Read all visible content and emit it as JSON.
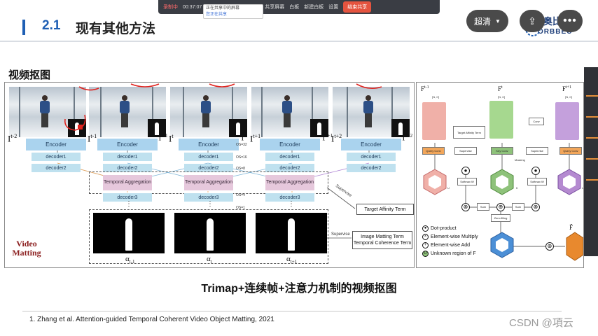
{
  "meeting_bar": {
    "record_label": "录制中",
    "timer": "00:37:07",
    "tip_line1": "正在共享中的屏幕",
    "tip_line2": "您正在共享",
    "items": [
      "共享屏幕",
      "白板",
      "新建白板",
      "设置",
      "结束共享"
    ],
    "end_label": "结束共享"
  },
  "slide": {
    "section_number": "2.1",
    "section_title": "现有其他方法",
    "subheading": "视频抠图",
    "caption": "Trimap+连续帧+注意力机制的视频抠图",
    "reference": "1. Zhang et al. Attention-guided Temporal Coherent Video Object Matting, 2021"
  },
  "logo": {
    "cn": "奥比中光",
    "en": "ORBBEC"
  },
  "controls": {
    "quality_label": "超清",
    "quality_chevron": "chevron-down-icon",
    "share_icon": "share-icon",
    "more_icon": "more-icon"
  },
  "left_figure": {
    "frame_labels": [
      "I",
      "I",
      "I",
      "I",
      "I"
    ],
    "frame_superscripts": [
      "t-2",
      "t-1",
      "t",
      "t+1",
      "t+2"
    ],
    "trimap_labels": [
      "T",
      "T",
      "T",
      "T"
    ],
    "trimap_superscripts": [
      "t-1",
      "t",
      "t+1",
      "t+2"
    ],
    "encoder_label": "Encoder",
    "decoder1_label": "decoder1",
    "decoder2_label": "decoder2",
    "decoder3_label": "decoder3",
    "ta_label": "Temporal Aggregation",
    "scale_labels": [
      "OS=32",
      "OS=16",
      "OS=8",
      "OS=4",
      "OS=1"
    ],
    "supervise_label": "Supervise",
    "target_affinity_term": "Target Affinity Term",
    "image_matting_term": "Image Matting Term",
    "temporal_coherence_term": "Temporal Coherence Term",
    "video_matting_label_1": "Video",
    "video_matting_label_2": "Matting",
    "alpha_labels": [
      "α",
      "α",
      "α"
    ],
    "alpha_subscripts": [
      "t-1",
      "t",
      "t+1"
    ],
    "dots": "⋮"
  },
  "right_figure": {
    "feature_labels": [
      "F",
      "F",
      "F"
    ],
    "feature_superscripts": [
      "t-1",
      "t",
      "t+1"
    ],
    "dims": [
      "[N, C]",
      "[N, C]",
      "[N, C]"
    ],
    "target_affinity": "Target Affinity Term",
    "supervise": "Supervise",
    "query_conv": "Query Conv",
    "key_conv": "Key Conv",
    "conv": "Conv",
    "extract_masking": "Extract & Masking",
    "masking": "Masking",
    "softmax": "Softmax W",
    "sum": "Sum",
    "zero_filling": "Zero-filling",
    "u_labels": [
      "U",
      "K",
      "U"
    ],
    "legend": [
      "Dot-product",
      "Element-wise Multiply",
      "Element-wise Add",
      "Unknown region of F"
    ],
    "f_hat": "F̂"
  },
  "watermark": "CSDN @項云"
}
